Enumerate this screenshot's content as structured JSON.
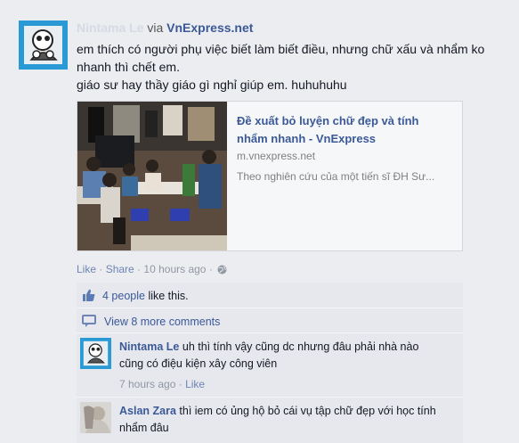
{
  "post": {
    "author": "Nintama Le",
    "via": "via",
    "via_source": "VnExpress.net",
    "text_line1": "em thích có người phụ việc biết làm biết điều, nhưng chữ xấu và nhẩm ko nhanh thì chết em.",
    "text_line2": "giáo sư hay thầy giáo gì nghỉ giúp em. huhuhuhu"
  },
  "link": {
    "title": "Đề xuất bỏ luyện chữ đẹp và tính nhẩm nhanh - VnExpress",
    "domain": "m.vnexpress.net",
    "description": "Theo nghiên cứu của một tiến sĩ ĐH Sư..."
  },
  "actions": {
    "like": "Like",
    "share": "Share",
    "time": "10 hours ago",
    "separator": "·"
  },
  "likes": {
    "count": "4 people",
    "suffix": "like this."
  },
  "more_comments": "View 8 more comments",
  "comments": [
    {
      "name": "Nintama Le",
      "text": "uh thì tính vậy cũng dc nhưng đâu phải nhà nào cũng có điệu kiện xây công viên",
      "time": "7 hours ago",
      "like": "Like"
    },
    {
      "name": "Aslan Zara",
      "text": "thì iem có ủng hộ bỏ cái vụ tập chữ đẹp với học tính nhẩm đâu"
    }
  ],
  "colors": {
    "link_blue": "#3b5998",
    "meta_gray": "#9197a3",
    "ufi_bg": "#e6e8ee",
    "page_bg": "#ecedf0"
  },
  "icons": [
    "avatar-cartoon-icon",
    "globe-icon",
    "thumbs-up-icon",
    "comment-bubble-icon"
  ]
}
